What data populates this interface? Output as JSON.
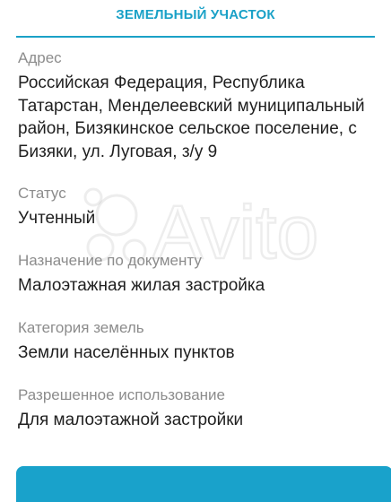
{
  "header": {
    "title": "ЗЕМЕЛЬНЫЙ УЧАСТОК"
  },
  "fields": [
    {
      "label": "Адрес",
      "value": "Российская Федерация, Республика Татарстан, Менделеевский муниципальный район, Бизякинское сельское поселение, с Бизяки, ул. Луговая, з/у 9"
    },
    {
      "label": "Статус",
      "value": "Учтенный"
    },
    {
      "label": "Назначение по документу",
      "value": "Малоэтажная жилая застройка"
    },
    {
      "label": "Категория земель",
      "value": "Земли населённых пунктов"
    },
    {
      "label": "Разрешенное использование",
      "value": "Для малоэтажной застройки"
    }
  ],
  "watermark": {
    "text": "Avito",
    "icon": "avito-logo-icon"
  },
  "colors": {
    "accent": "#1aa1c7",
    "label": "#8c8c8c",
    "text": "#1f1f1f",
    "button": "#19a2cb"
  }
}
